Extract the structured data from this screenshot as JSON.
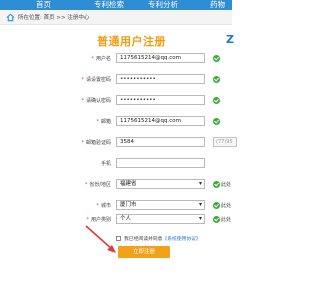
{
  "nav": {
    "items": [
      "首页",
      "专利检索",
      "专利分析",
      "药物"
    ]
  },
  "breadcrumb": {
    "text": "所在位置: 首页 >> 注册中心"
  },
  "form": {
    "title": "普通用户注册",
    "title_suffix": "Z",
    "fields": [
      {
        "label": "用户名",
        "required": true,
        "value": "1175615214@qq.com",
        "status": "ok"
      },
      {
        "label": "请设置密码",
        "required": true,
        "value": "•••••••••••",
        "status": "ok"
      },
      {
        "label": "请确认密码",
        "required": true,
        "value": "•••••••••••",
        "status": "ok"
      },
      {
        "label": "邮箱",
        "required": true,
        "value": "1175615214@qq.com",
        "status": "ok"
      },
      {
        "label": "邮箱验证码",
        "required": true,
        "value": "3584",
        "status": "code"
      },
      {
        "label": "手机",
        "required": false,
        "value": "",
        "status": "none"
      },
      {
        "label": "省份/地区",
        "required": true,
        "value": "福建省",
        "status": "hint"
      },
      {
        "label": "城市",
        "required": true,
        "value": "厦门市",
        "status": "hint"
      },
      {
        "label": "用户类别",
        "required": true,
        "value": "个人",
        "status": "hint"
      }
    ],
    "verify_code_display": "(77)95",
    "hint_text": "此处",
    "agree_text": "我已经阅读并同意",
    "agree_link": "《系统使用协议》",
    "submit_label": "立即注册"
  },
  "colors": {
    "nav": "#2f8ed3",
    "title": "#f39c12",
    "ok": "#3cab3c",
    "submit": "#f0a21b",
    "arrow": "#e33a3a"
  }
}
